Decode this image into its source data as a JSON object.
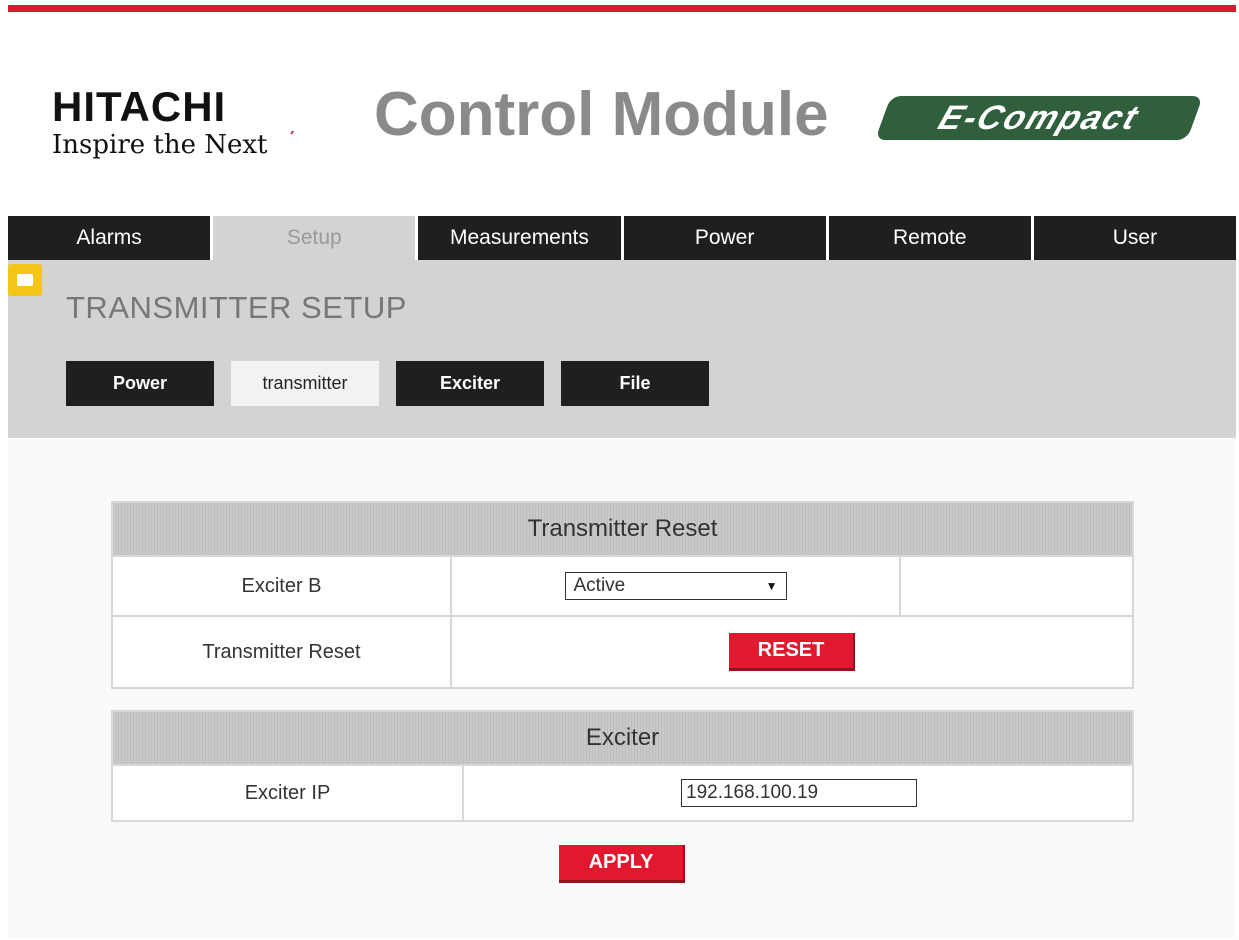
{
  "brand": {
    "logo_name": "HITACHI",
    "logo_tagline": "Inspire the Next",
    "app_title": "Control Module",
    "product_badge": "E-Compact"
  },
  "nav": {
    "tabs": [
      {
        "label": "Alarms",
        "active": false
      },
      {
        "label": "Setup",
        "active": true
      },
      {
        "label": "Measurements",
        "active": false
      },
      {
        "label": "Power",
        "active": false
      },
      {
        "label": "Remote",
        "active": false
      },
      {
        "label": "User",
        "active": false
      }
    ]
  },
  "page": {
    "section_title": "TRANSMITTER SETUP",
    "subtabs": [
      {
        "label": "Power",
        "active": false
      },
      {
        "label": "transmitter",
        "active": true
      },
      {
        "label": "Exciter",
        "active": false
      },
      {
        "label": "File",
        "active": false
      }
    ]
  },
  "transmitter_reset": {
    "header": "Transmitter Reset",
    "exciter_b_label": "Exciter B",
    "exciter_b_value": "Active",
    "reset_label": "Transmitter Reset",
    "reset_button": "RESET"
  },
  "exciter": {
    "header": "Exciter",
    "ip_label": "Exciter IP",
    "ip_value": "192.168.100.19"
  },
  "apply_button": "APPLY",
  "colors": {
    "accent_red": "#e0192f",
    "nav_dark": "#1f1f1f",
    "panel_gray": "#d3d3d3",
    "badge_green": "#2f5f3c",
    "note_yellow": "#f5c518"
  }
}
